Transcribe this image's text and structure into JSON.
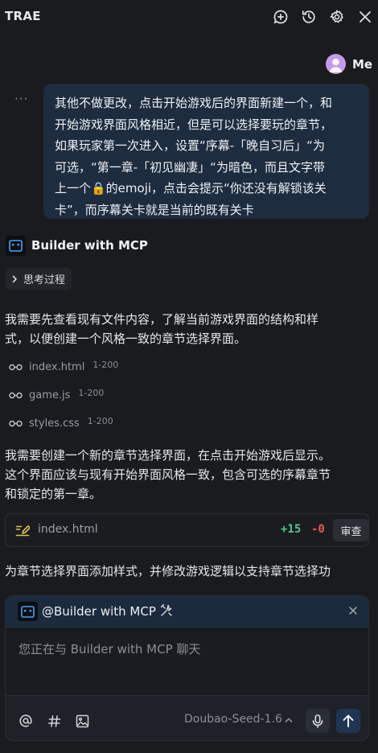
{
  "header": {
    "title": "TRAE",
    "icons": [
      "add-chat-icon",
      "history-icon",
      "settings-icon",
      "close-icon"
    ]
  },
  "user": {
    "name": "Me",
    "lines": [
      "其他不做更改，点击开始游戏后的界面新建一个，和",
      "开始游戏界面风格相近，但是可以选择要玩的章节，",
      "如果玩家第一次进入，设置“序幕-「晚自习后」“为",
      "可选，“第一章-「初见幽凄」“为暗色，而且文字带",
      "上一个🔒的emoji，点击会提示“你还没有解锁该关",
      "卡”，而序幕关卡就是当前的既有关卡"
    ]
  },
  "assistant": {
    "name": "Builder with MCP",
    "thinking_label": "思考过程",
    "para1_lines": [
      "我需要先查看现有文件内容，了解当前游戏界面的结构和样",
      "式，以便创建一个风格一致的章节选择界面。"
    ],
    "files": [
      {
        "name": "index.html",
        "range": "1-200"
      },
      {
        "name": "game.js",
        "range": "1-200"
      },
      {
        "name": "styles.css",
        "range": "1-200"
      }
    ],
    "para2_lines": [
      "我需要创建一个新的章节选择界面，在点击开始游戏后显示。",
      "这个界面应该与现有开始界面风格一致，包含可选的序幕章节",
      "和锁定的第一章。"
    ],
    "edit": {
      "file": "index.html",
      "added": "+15",
      "removed": "-0",
      "review_label": "审查"
    },
    "para3": "为章节选择界面添加样式，并修改游戏逻辑以支持章节选择功"
  },
  "composer": {
    "context_label": "@Builder with MCP",
    "placeholder": "您正在与 Builder with MCP 聊天",
    "model": "Doubao-Seed-1.6",
    "tools": [
      "at-icon",
      "hash-icon",
      "image-icon"
    ]
  }
}
